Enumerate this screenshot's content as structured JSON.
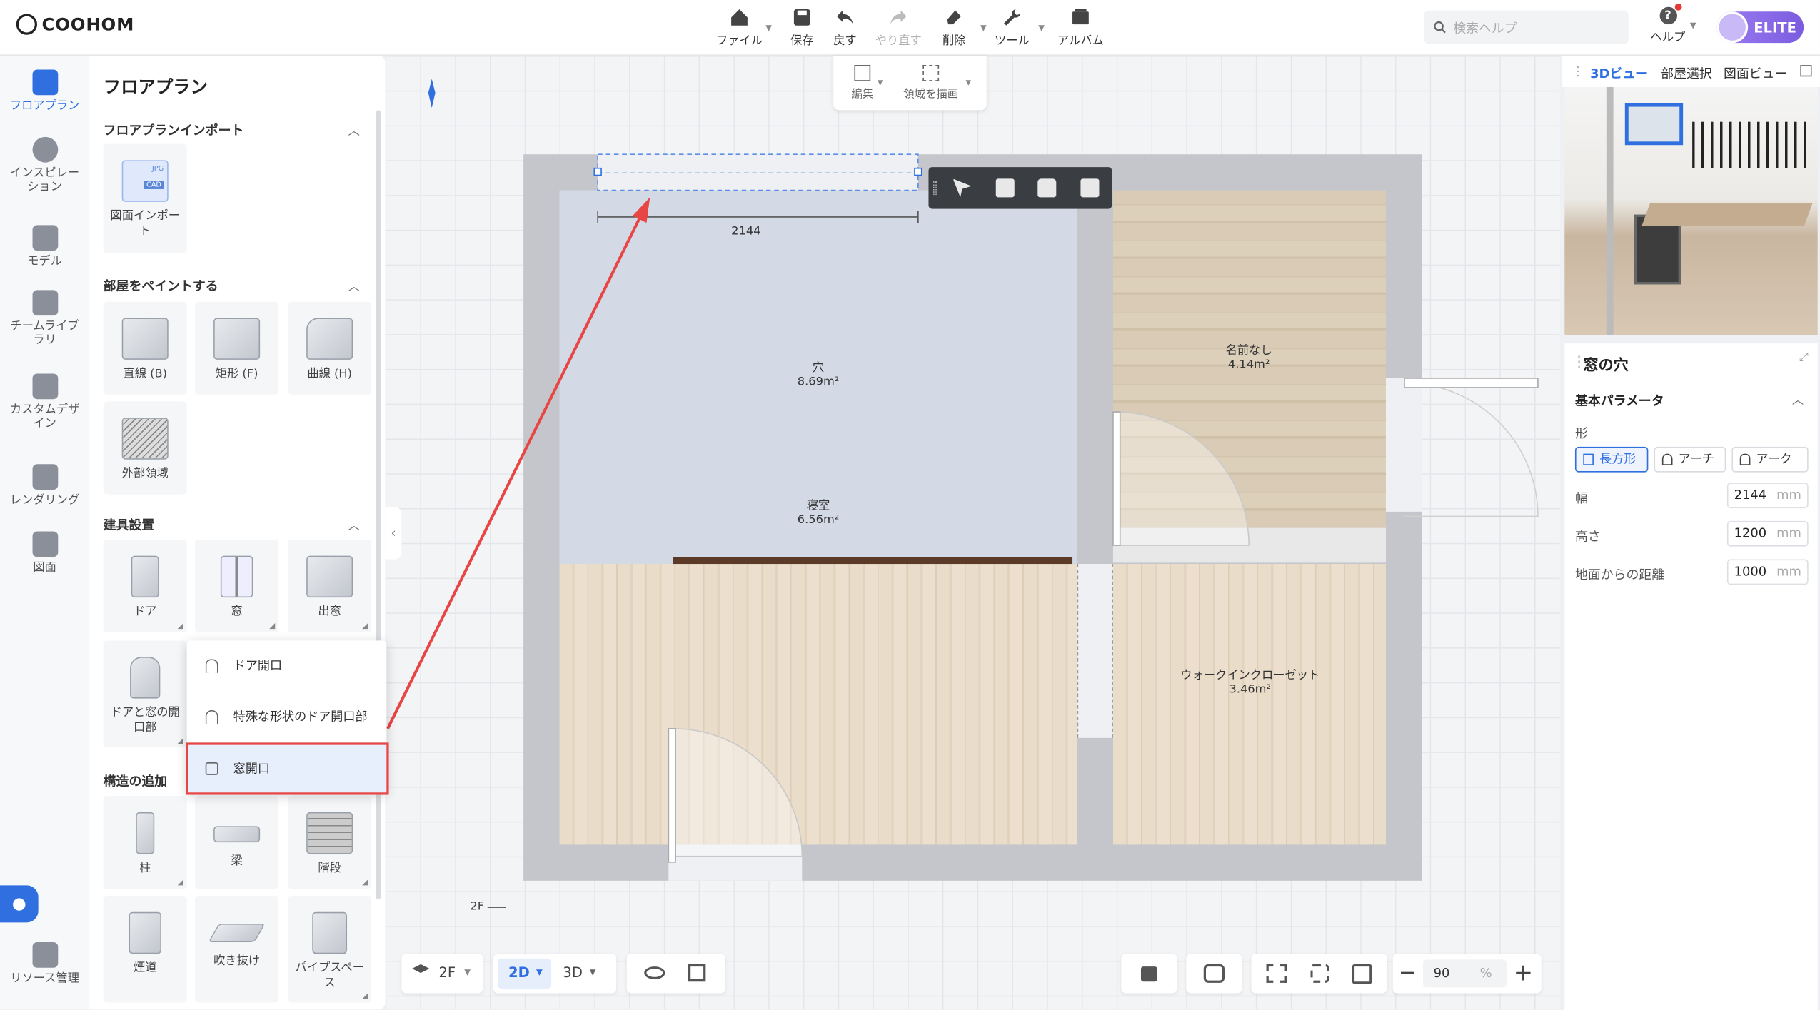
{
  "app": {
    "logo": "COOHOM"
  },
  "toolbar": {
    "file": "ファイル",
    "save": "保存",
    "undo": "戻す",
    "redo": "やり直す",
    "delete": "削除",
    "tools": "ツール",
    "album": "アルバム"
  },
  "search": {
    "placeholder": "検索ヘルプ"
  },
  "help": {
    "label": "ヘルプ"
  },
  "account": {
    "badge": "ELITE"
  },
  "rail": {
    "items": [
      {
        "label": "フロアプラン"
      },
      {
        "label": "インスピレーション"
      },
      {
        "label": "モデル"
      },
      {
        "label": "チームライブラリ"
      },
      {
        "label": "カスタムデザイン"
      },
      {
        "label": "レンダリング"
      },
      {
        "label": "図面"
      }
    ],
    "bottom": "リソース管理"
  },
  "panel": {
    "title": "フロアプラン",
    "sections": {
      "import": "フロアプランインポート",
      "paint": "部屋をペイントする",
      "fixtures": "建具設置",
      "structure": "構造の追加"
    },
    "import_items": [
      {
        "label": "図面インポート"
      }
    ],
    "import_badges": {
      "jpg": "JPG",
      "cad": "CAD"
    },
    "paint_items": [
      {
        "label": "直線 (B)"
      },
      {
        "label": "矩形 (F)"
      },
      {
        "label": "曲線 (H)"
      },
      {
        "label": "外部領域"
      }
    ],
    "fixture_items": [
      {
        "label": "ドア"
      },
      {
        "label": "窓"
      },
      {
        "label": "出窓"
      },
      {
        "label": "ドアと窓の開口部"
      }
    ],
    "structure_items": [
      {
        "label": "柱"
      },
      {
        "label": "梁"
      },
      {
        "label": "階段"
      },
      {
        "label": "煙道"
      },
      {
        "label": "吹き抜け"
      },
      {
        "label": "パイプスペース"
      }
    ]
  },
  "popup": {
    "items": [
      {
        "label": "ドア開口"
      },
      {
        "label": "特殊な形状のドア開口部"
      },
      {
        "label": "窓開口"
      }
    ]
  },
  "edit_toolbar": {
    "edit": "編集",
    "draw_area": "領域を描画"
  },
  "plan": {
    "dimension": "2144",
    "rooms": [
      {
        "name": "穴",
        "area": "8.69m²"
      },
      {
        "name": "寝室",
        "area": "6.56m²"
      },
      {
        "name": "名前なし",
        "area": "4.14m²"
      },
      {
        "name": "ウォークインクローゼット",
        "area": "3.46m²"
      }
    ],
    "floor_marker": "2F"
  },
  "bottom": {
    "floor": "2F",
    "view2d": "2D",
    "view3d": "3D",
    "zoom": "90",
    "zoom_unit": "%"
  },
  "right": {
    "tabs": [
      "3Dビュー",
      "部屋選択",
      "図面ビュー"
    ],
    "title": "窓の穴",
    "section": "基本パラメータ",
    "shape_label": "形",
    "shapes": [
      "長方形",
      "アーチ",
      "アーク"
    ],
    "params": [
      {
        "label": "幅",
        "value": "2144",
        "unit": "mm"
      },
      {
        "label": "高さ",
        "value": "1200",
        "unit": "mm"
      },
      {
        "label": "地面からの距離",
        "value": "1000",
        "unit": "mm"
      }
    ]
  },
  "colors": {
    "accent": "#2f6fe0",
    "highlight": "#e84545",
    "wall": "#c4c6cb"
  }
}
